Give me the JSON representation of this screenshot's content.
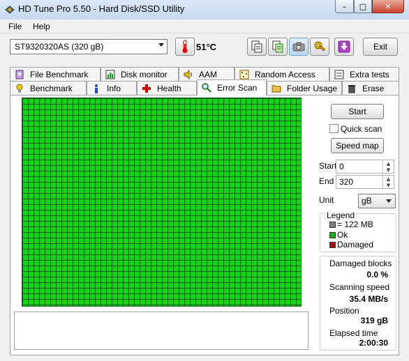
{
  "window": {
    "title": "HD Tune Pro 5.50 - Hard Disk/SSD Utility",
    "minimize": "–",
    "maximize": "□",
    "close": "✕"
  },
  "menu": {
    "file": "File",
    "help": "Help"
  },
  "toolbar": {
    "drive": "ST9320320AS (320 gB)",
    "temperature": "51°C",
    "exit_label": "Exit",
    "icons": [
      "copy-icon",
      "copy-info-icon",
      "camera-icon",
      "options-icon",
      "download-icon"
    ]
  },
  "tabs": {
    "row1": [
      "File Benchmark",
      "Disk monitor",
      "AAM",
      "Random Access",
      "Extra tests"
    ],
    "row2": [
      "Benchmark",
      "Info",
      "Health",
      "Error Scan",
      "Folder Usage",
      "Erase"
    ],
    "active": "Error Scan"
  },
  "errorscan": {
    "start_label": "Start",
    "quick_scan_label": "Quick scan",
    "quick_scan_checked": false,
    "speed_map_label": "Speed map",
    "start_field_label": "Start",
    "start_value": "0",
    "end_field_label": "End",
    "end_value": "320",
    "unit_label": "Unit",
    "unit_value": "gB",
    "legend": {
      "title": "Legend",
      "items": [
        {
          "label": "= 122 MB",
          "color": "#808080"
        },
        {
          "label": "Ok",
          "color": "#00c000"
        },
        {
          "label": "Damaged",
          "color": "#c00000"
        }
      ]
    },
    "stats": {
      "damaged_label": "Damaged blocks",
      "damaged_value": "0.0 %",
      "speed_label": "Scanning speed",
      "speed_value": "35.4 MB/s",
      "position_label": "Position",
      "position_value": "319 gB",
      "elapsed_label": "Elapsed time",
      "elapsed_value": "2:00:30"
    },
    "grid_color": "#00e000"
  }
}
